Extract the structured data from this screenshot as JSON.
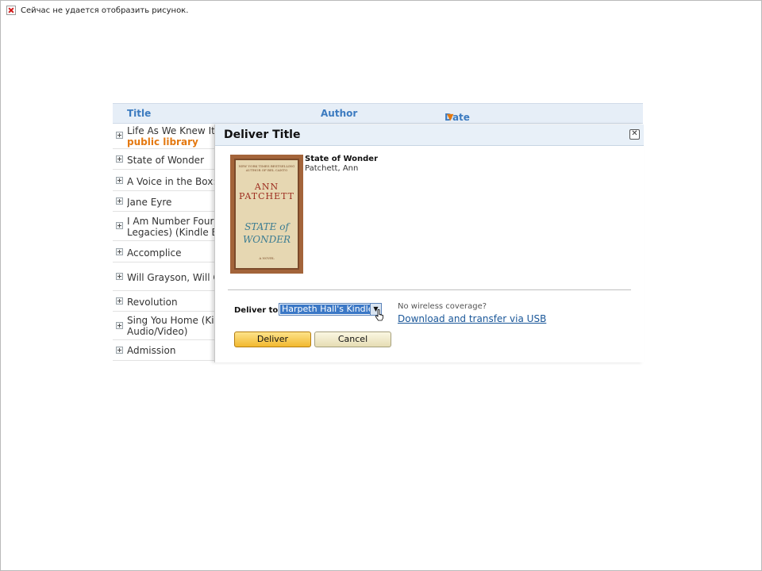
{
  "broken_image": {
    "message": "Сейчас не удается отобразить рисунок."
  },
  "list": {
    "headers": {
      "title": "Title",
      "author": "Author",
      "date": "Date",
      "date_sort": "▼"
    },
    "rows": [
      {
        "text": "Life As We Knew It (",
        "sub": "public library"
      },
      {
        "text": "State of Wonder"
      },
      {
        "text": "A Voice in the Box: M"
      },
      {
        "text": "Jane Eyre"
      },
      {
        "text": "I Am Number Four M",
        "line2": "Legacies) (Kindle Edi"
      },
      {
        "text": "Accomplice"
      },
      {
        "text": "Will Grayson, Will Gr"
      },
      {
        "text": "Revolution"
      },
      {
        "text": "Sing You Home (Kinc",
        "line2": "Audio/Video)"
      },
      {
        "text": "Admission"
      }
    ]
  },
  "dialog": {
    "title": "Deliver Title",
    "close_icon": "close-icon",
    "book": {
      "title": "State of Wonder",
      "author": "Patchett, Ann",
      "cover": {
        "top_text": "NEW YORK TIMES BESTSELLING AUTHOR OF BEL CANTO",
        "author_line1": "ANN",
        "author_line2": "PATCHETT",
        "title_line1": "STATE of",
        "title_line2": "WONDER",
        "sub": "A NOVEL"
      }
    },
    "deliver_label": "Deliver to:",
    "device_selected": "Harpeth Hall's Kindle",
    "no_wireless": "No wireless coverage?",
    "usb_link": "Download and transfer via USB",
    "deliver_button": "Deliver",
    "cancel_button": "Cancel"
  },
  "colors": {
    "accent": "#e47911",
    "header_text": "#3c7bc0",
    "link": "#1a5799",
    "selection": "#3b78c6"
  }
}
